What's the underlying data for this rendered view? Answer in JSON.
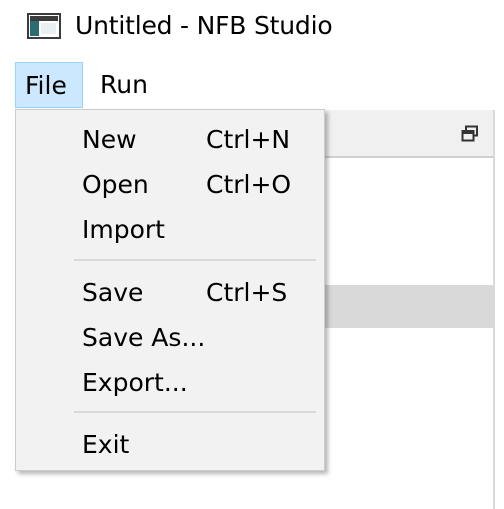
{
  "window": {
    "title": "Untitled - NFB Studio",
    "icon": "app-window-icon"
  },
  "menubar": {
    "file_label": "File",
    "run_label": "Run",
    "active_menu": "File"
  },
  "child_window": {
    "restore_icon": "restore-icon"
  },
  "file_menu": {
    "items": [
      {
        "label": "New",
        "shortcut": "Ctrl+N"
      },
      {
        "label": "Open",
        "shortcut": "Ctrl+O"
      },
      {
        "label": "Import",
        "shortcut": ""
      },
      {
        "label": "Save",
        "shortcut": "Ctrl+S"
      },
      {
        "label": "Save As...",
        "shortcut": ""
      },
      {
        "label": "Export...",
        "shortcut": ""
      },
      {
        "label": "Exit",
        "shortcut": ""
      }
    ]
  },
  "colors": {
    "menu_highlight": "#cce8ff",
    "menu_highlight_border": "#99d1ff",
    "dropdown_bg": "#f2f2f2",
    "separator": "#d9d9d9",
    "selected_row": "#d9d9d9"
  }
}
